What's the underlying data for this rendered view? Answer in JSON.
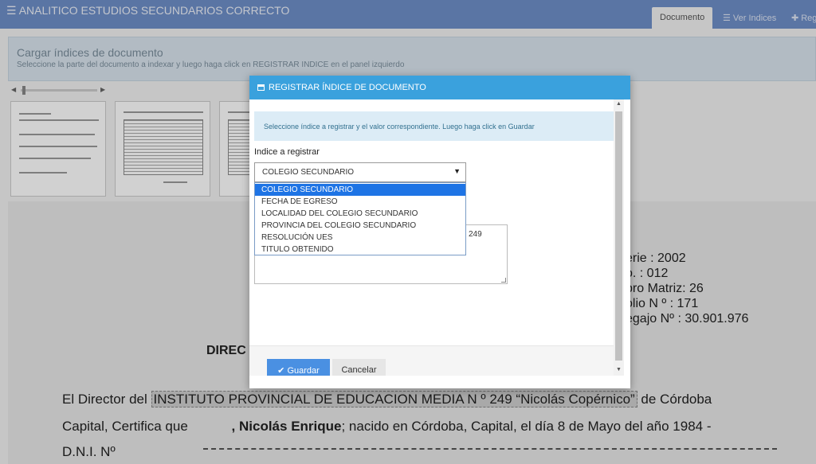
{
  "app": {
    "title": "ANALITICO ESTUDIOS SECUNDARIOS CORRECTO",
    "menu_icon": "☰",
    "tabs": [
      {
        "label": "Documento",
        "icon": ""
      },
      {
        "label": "Ver Indices",
        "icon": "☰"
      },
      {
        "label": "Reg",
        "icon": "✚"
      }
    ]
  },
  "page": {
    "title": "Cargar índices de documento",
    "subtitle": "Seleccione la parte del documento a indexar y luego haga click en REGISTRAR INDICE en el panel izquierdo"
  },
  "document": {
    "lines": {
      "serie": "erie          : 2002",
      "num": "o.          :  012",
      "libro": "bro Matriz:      26",
      "folio": "olio N º      :    171",
      "legajo": "egajo Nº    :  30.901.976",
      "heading": "DIREC",
      "body1_pre": "El Director del",
      "body1_highlight": "INSTITUTO PROVINCIAL DE EDUCACION MEDIA N º 249 “Nicolás Copérnico”",
      "body1_post": "de   Córdoba",
      "body2_pre": "Capital, Certifica que",
      "body2_name": ", Nicolás Enrique",
      "body2_post": "; nacido en Córdoba, Capital, el día 8 de Mayo del año 1984 -",
      "body3": "D.N.I. Nº"
    }
  },
  "modal": {
    "title": "REGISTRAR ÍNDICE DE DOCUMENTO",
    "info": "Seleccione índice a registrar y el valor correspondiente. Luego haga click en Guardar",
    "field_label": "Indice a registrar",
    "selected_value": "COLEGIO SECUNDARIO",
    "textarea_value": "249",
    "options": [
      "COLEGIO SECUNDARIO",
      "FECHA DE EGRESO",
      "LOCALIDAD DEL COLEGIO SECUNDARIO",
      "PROVINCIA DEL COLEGIO SECUNDARIO",
      "RESOLUCIÓN UES",
      "TITULO OBTENIDO"
    ],
    "save_label": "Guardar",
    "cancel_label": "Cancelar"
  },
  "colors": {
    "navbar": "#6e8fc9",
    "modal_header": "#3aa1dd",
    "primary_button": "#4a90e2",
    "selected_option": "#1e74e5"
  }
}
